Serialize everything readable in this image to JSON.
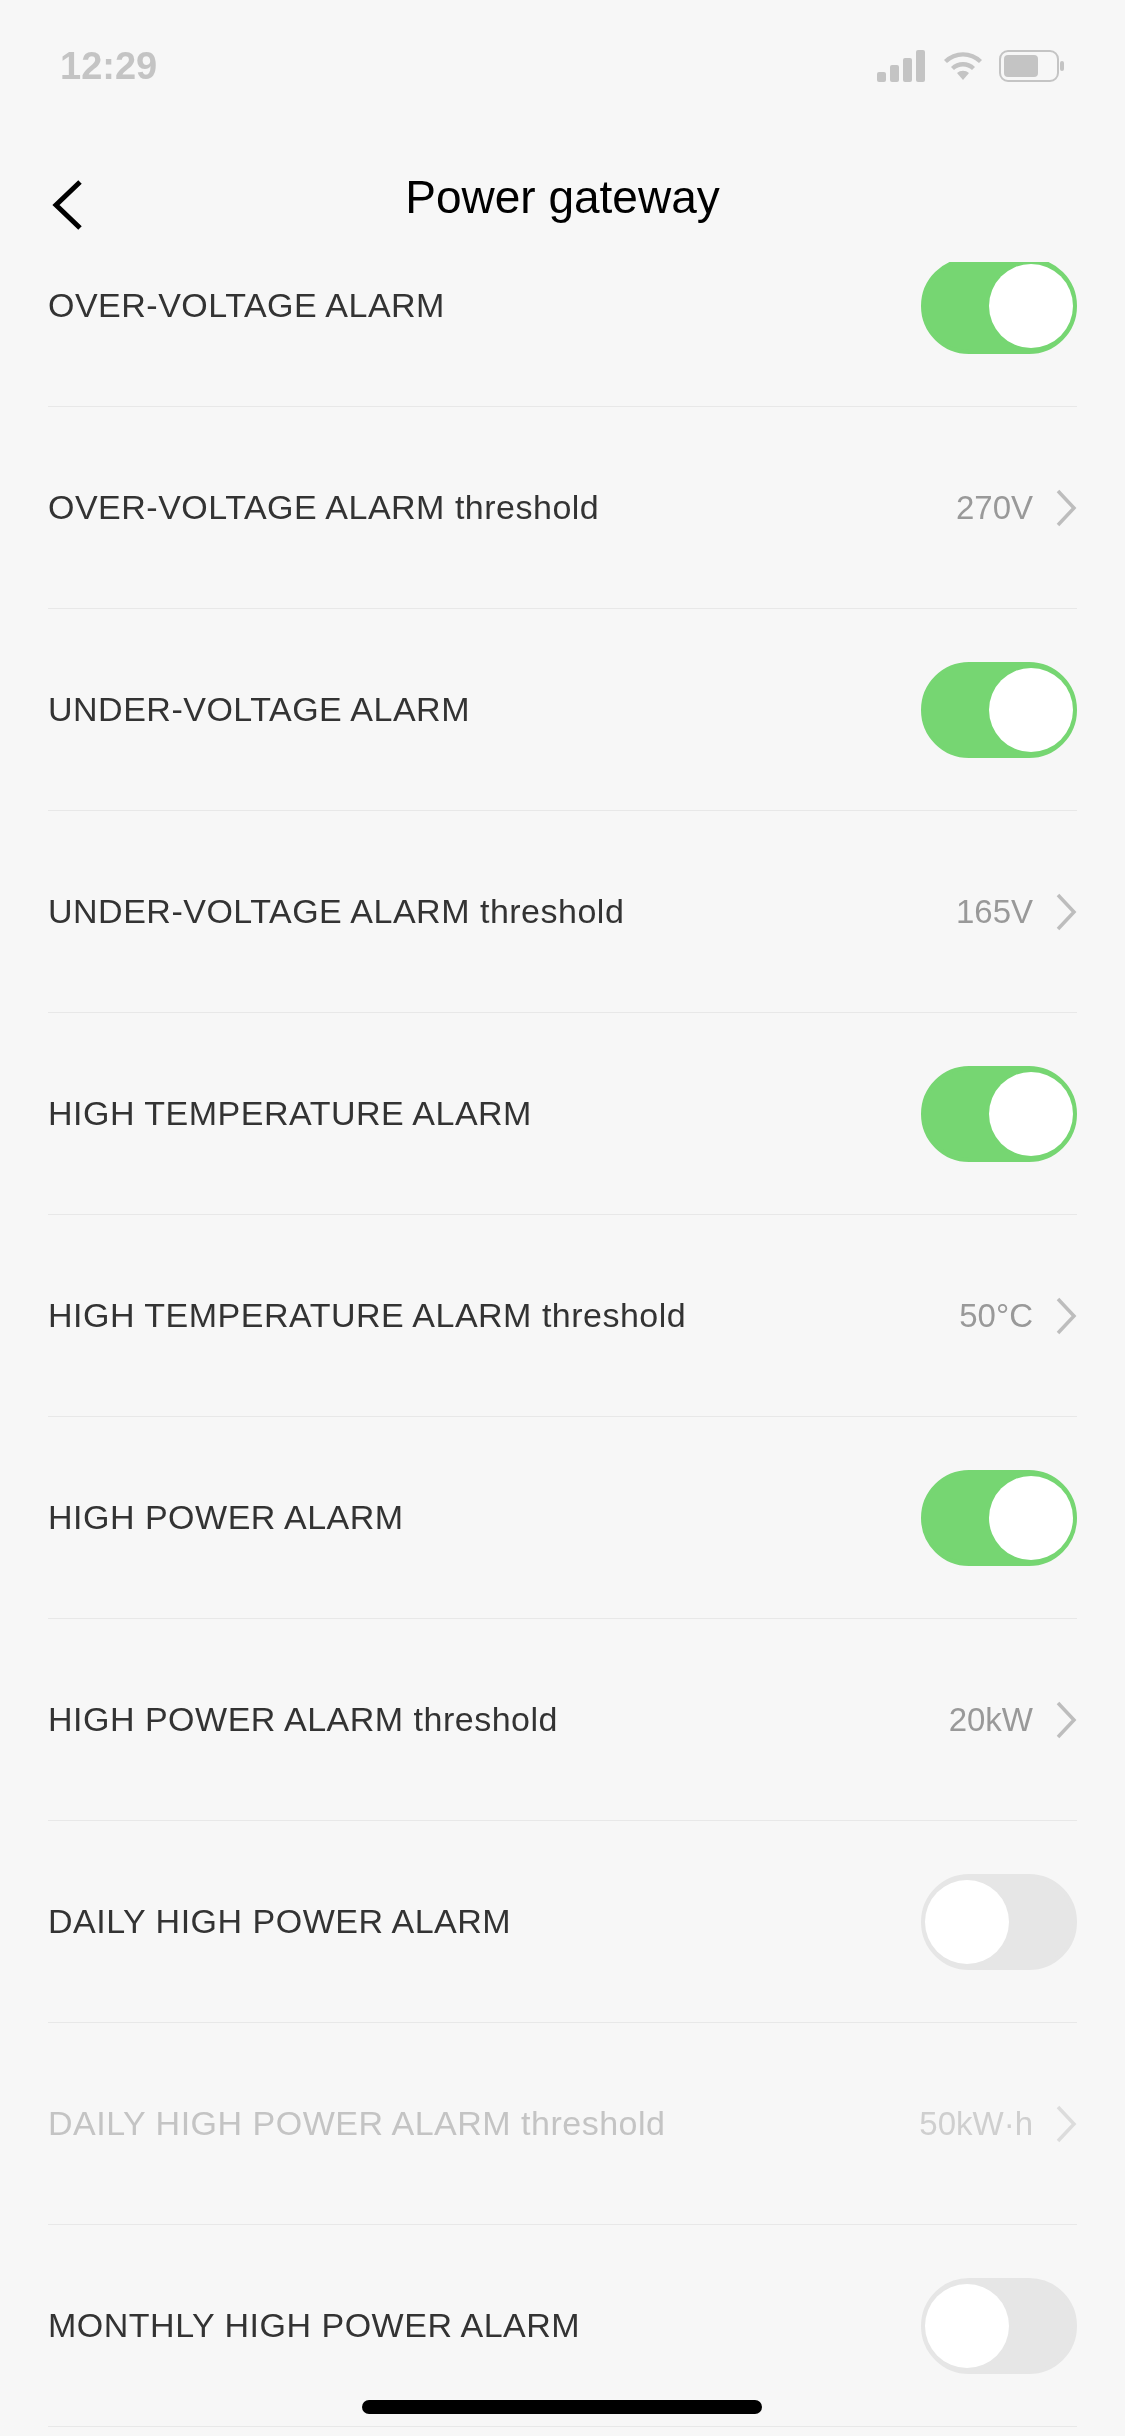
{
  "status_bar": {
    "time": "12:29"
  },
  "nav": {
    "title": "Power gateway"
  },
  "rows": [
    {
      "kind": "toggle",
      "label": "OVER-VOLTAGE ALARM",
      "on": true
    },
    {
      "kind": "link",
      "label": "OVER-VOLTAGE ALARM threshold",
      "value": "270V",
      "disabled": false
    },
    {
      "kind": "toggle",
      "label": "UNDER-VOLTAGE ALARM",
      "on": true
    },
    {
      "kind": "link",
      "label": "UNDER-VOLTAGE ALARM threshold",
      "value": "165V",
      "disabled": false
    },
    {
      "kind": "toggle",
      "label": "HIGH TEMPERATURE ALARM",
      "on": true
    },
    {
      "kind": "link",
      "label": "HIGH TEMPERATURE ALARM threshold",
      "value": "50°C",
      "disabled": false
    },
    {
      "kind": "toggle",
      "label": "HIGH POWER ALARM",
      "on": true
    },
    {
      "kind": "link",
      "label": "HIGH POWER ALARM threshold",
      "value": "20kW",
      "disabled": false
    },
    {
      "kind": "toggle",
      "label": "DAILY HIGH POWER ALARM",
      "on": false
    },
    {
      "kind": "link",
      "label": "DAILY HIGH POWER ALARM threshold",
      "value": "50kW·h",
      "disabled": true
    },
    {
      "kind": "toggle",
      "label": "MONTHLY HIGH POWER ALARM",
      "on": false
    }
  ]
}
